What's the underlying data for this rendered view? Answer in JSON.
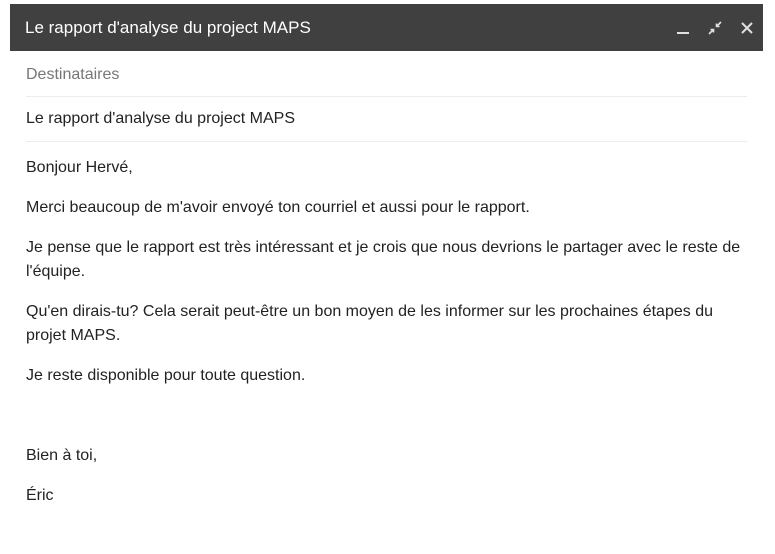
{
  "window": {
    "title": "Le rapport d'analyse du project MAPS"
  },
  "controls": {
    "minimize_icon": "minimize-icon",
    "expand_icon": "exit-fullscreen-icon",
    "close_icon": "close-icon"
  },
  "recipients": {
    "placeholder": "Destinataires"
  },
  "subject": {
    "value": "Le rapport d'analyse du project MAPS"
  },
  "message": {
    "greeting": "Bonjour Hervé,",
    "p1": "Merci beaucoup de m'avoir envoyé ton courriel et aussi pour le rapport.",
    "p2": "Je pense que le rapport est très intéressant et je crois que nous devrions le partager avec le reste de l'équipe.",
    "p3": "Qu'en dirais-tu? Cela serait peut-être un bon moyen de les informer sur les prochaines étapes du projet MAPS.",
    "p4": "Je reste disponible pour toute question.",
    "closing": "Bien à toi,",
    "signature": "Éric"
  },
  "colors": {
    "titlebar": "#404040",
    "title_text": "#ffffff",
    "placeholder_text": "#777777",
    "divider": "#ececec"
  }
}
